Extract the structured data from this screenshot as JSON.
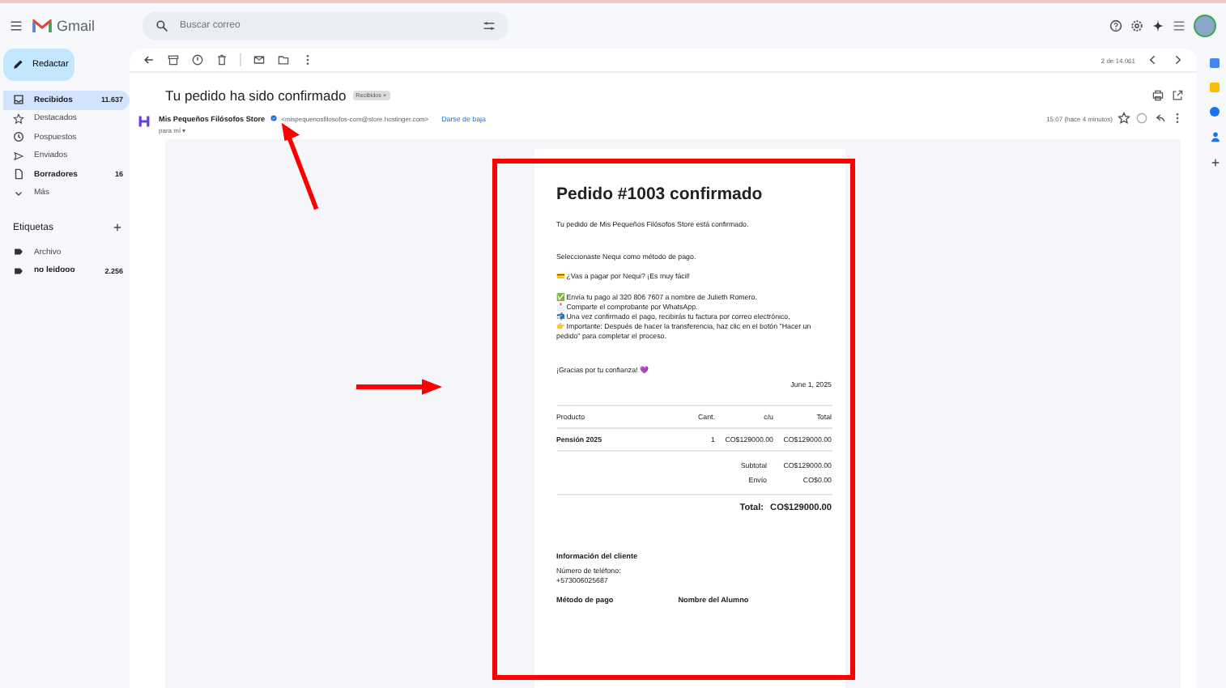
{
  "app": {
    "name": "Gmail"
  },
  "search": {
    "placeholder": "Buscar correo"
  },
  "compose": {
    "label": "Redactar"
  },
  "sidebar": {
    "items": [
      {
        "label": "Recibidos",
        "count": "11.637",
        "selected": true,
        "unread": true
      },
      {
        "label": "Destacados",
        "selected": false,
        "unread": false
      },
      {
        "label": "Pospuestos",
        "selected": false,
        "unread": false
      },
      {
        "label": "Enviados",
        "selected": false,
        "unread": false
      },
      {
        "label": "Borradores",
        "count": "16",
        "selected": false,
        "unread": true
      },
      {
        "label": "Más",
        "selected": false,
        "unread": false
      }
    ],
    "labels_title": "Etiquetas",
    "labels": [
      {
        "label": "Archivo",
        "unread": false
      },
      {
        "label": "no leidooo",
        "count": "2.256",
        "unread": true
      }
    ]
  },
  "toolbar": {
    "position": "2 de 14.061"
  },
  "message": {
    "subject": "Tu pedido ha sido confirmado",
    "tag": "Recibidos ×",
    "sender": "Mis Pequeños Filósofos Store",
    "address": "<mispequenosfilosofos-com@store.hostinger.com>",
    "unsubscribe": "Darse de baja",
    "to": "para mí ▾",
    "time": "15:07 (hace 4 minutos)"
  },
  "email": {
    "title": "Pedido #1003 confirmado",
    "paragraphs": [
      "Tu pedido de Mis Pequeños Filósofos Store está confirmado.",
      "Seleccionaste Nequi como método de pago.",
      "💳 ¿Vas a pagar por Nequi? ¡Es muy fácil!",
      "✅ Envía tu pago al 320 806 7607 a nombre de Julieth Romero.",
      "📩 Comparte el comprobante por WhatsApp.",
      "📬 Una vez confirmado el pago, recibirás tu factura por correo electrónico.",
      "👉 Importante: Después de hacer la transferencia, haz clic en el botón \"Hacer un pedido\" para completar el proceso.",
      "¡Gracias por tu confianza! 💜"
    ],
    "date": "June 1, 2025",
    "columns": [
      "Producto",
      "Cant.",
      "c/u",
      "Total"
    ],
    "rows": [
      [
        "Pensión 2025",
        "1",
        "CO$129000.00",
        "CO$129000.00"
      ]
    ],
    "summary": [
      {
        "label": "Subtotal",
        "value": "CO$129000.00"
      },
      {
        "label": "Envío",
        "value": "CO$0.00"
      }
    ],
    "total": {
      "label": "Total:",
      "value": "CO$129000.00"
    },
    "customer_title": "Información del cliente",
    "phone_label": "Número de teléfono:",
    "phone": "+573006025687",
    "bottom_headings": [
      "Método de pago",
      "Nombre del Alumno"
    ]
  }
}
